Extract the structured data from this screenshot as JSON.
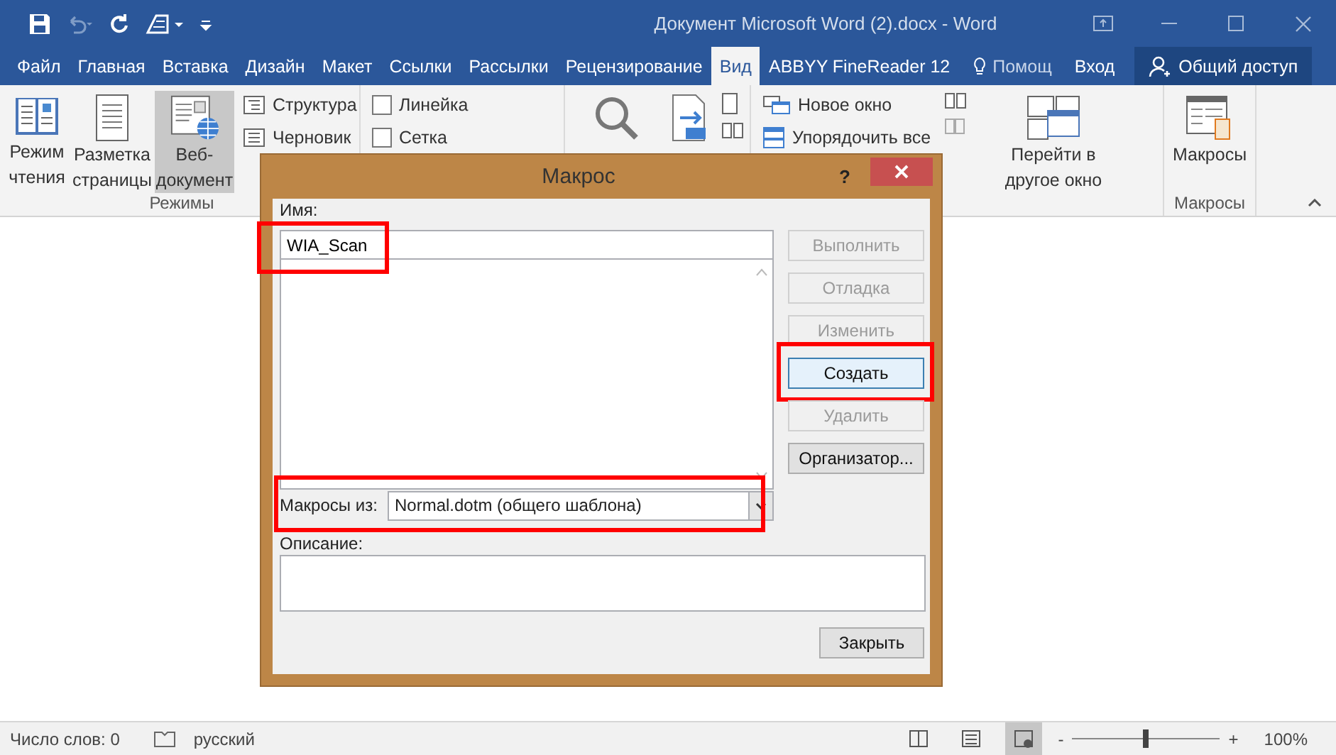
{
  "window": {
    "title": "Документ Microsoft Word (2).docx - Word"
  },
  "tabs": [
    {
      "label": "Файл",
      "selected": false
    },
    {
      "label": "Главная",
      "selected": false
    },
    {
      "label": "Вставка",
      "selected": false
    },
    {
      "label": "Дизайн",
      "selected": false
    },
    {
      "label": "Макет",
      "selected": false
    },
    {
      "label": "Ссылки",
      "selected": false
    },
    {
      "label": "Рассылки",
      "selected": false
    },
    {
      "label": "Рецензирование",
      "selected": false
    },
    {
      "label": "Вид",
      "selected": true
    },
    {
      "label": "ABBYY FineReader 12",
      "selected": false
    }
  ],
  "tell_me": "Помощ",
  "sign_in": "Вход",
  "share": "Общий доступ",
  "views_group": {
    "label": "Режимы",
    "buttons": [
      {
        "kind": "book",
        "lines": [
          "Режим",
          "чтения"
        ],
        "selected": false
      },
      {
        "kind": "page",
        "lines": [
          "Разметка",
          "страницы"
        ],
        "selected": false
      },
      {
        "kind": "web",
        "lines": [
          "Веб-",
          "документ"
        ],
        "selected": true
      }
    ],
    "small": [
      {
        "kind": "outline",
        "label": "Структура"
      },
      {
        "kind": "draft",
        "label": "Черновик"
      }
    ]
  },
  "show_group": {
    "checkboxes": [
      {
        "label": "Линейка",
        "checked": false
      },
      {
        "label": "Сетка",
        "checked": false
      }
    ]
  },
  "window_group": {
    "small": [
      {
        "kind": "new-window",
        "label": "Новое окно"
      },
      {
        "kind": "arrange",
        "label": "Упорядочить все"
      }
    ],
    "switch_lines": [
      "Перейти в",
      "другое окно"
    ]
  },
  "macros_group": {
    "button": "Макросы",
    "label": "Макросы"
  },
  "dialog": {
    "title": "Макрос",
    "help": "?",
    "name_label": "Имя:",
    "name_value": "WIA_Scan",
    "name_highlighted": true,
    "buttons": [
      {
        "label": "Выполнить",
        "disabled": true,
        "default": false,
        "highlighted": false
      },
      {
        "label": "Отладка",
        "disabled": true,
        "default": false,
        "highlighted": false
      },
      {
        "label": "Изменить",
        "disabled": true,
        "default": false,
        "highlighted": false
      },
      {
        "label": "Создать",
        "disabled": false,
        "default": true,
        "highlighted": true
      },
      {
        "label": "Удалить",
        "disabled": true,
        "default": false,
        "highlighted": false
      },
      {
        "label": "Организатор...",
        "disabled": false,
        "default": false,
        "highlighted": false
      }
    ],
    "macros_from_label": "Макросы из:",
    "macros_from_value": "Normal.dotm (общего шаблона)",
    "macros_from_highlighted": true,
    "description_label": "Описание:",
    "close_button": "Закрыть"
  },
  "status_bar": {
    "word_count": "Число слов: 0",
    "language": "русский",
    "views": [
      {
        "kind": "read",
        "selected": false
      },
      {
        "kind": "print",
        "selected": false
      },
      {
        "kind": "web",
        "selected": true
      }
    ],
    "zoom_out": "-",
    "zoom_in": "+",
    "zoom": {
      "level": 0.5
    },
    "zoom_text": "100%"
  }
}
